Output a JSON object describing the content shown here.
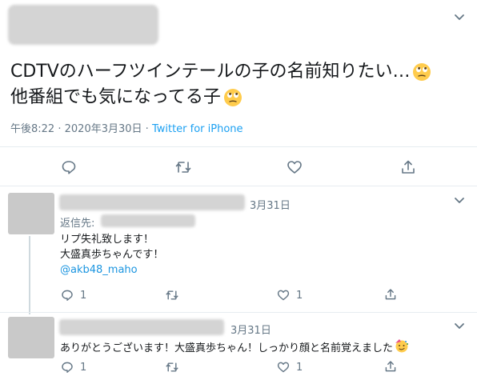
{
  "main_tweet": {
    "text_line1": "CDTVのハーフツインテールの子の名前知りたい…",
    "text_line2": "他番組でも気になってる子",
    "time": "午後8:22",
    "separator": "·",
    "date": "2020年3月30日",
    "source": "Twitter for iPhone",
    "emoji_icon": "face-with-rolling-eyes"
  },
  "replies": [
    {
      "date": "3月31日",
      "reply_to_label": "返信先:",
      "lines": [
        "リプ失礼致します！",
        "大盛真歩ちゃんです！"
      ],
      "mention": "@akb48_maho",
      "reply_count": "1",
      "like_count": "1"
    },
    {
      "date": "3月31日",
      "lines": [
        "ありがとうございます！大盛真歩ちゃん！しっかり顔と名前覚えました"
      ],
      "emoji_icon": "partying-face",
      "reply_count": "1",
      "like_count": "1"
    }
  ],
  "colors": {
    "link": "#1b95e0",
    "muted": "#657786",
    "divider": "#e6ecf0"
  }
}
